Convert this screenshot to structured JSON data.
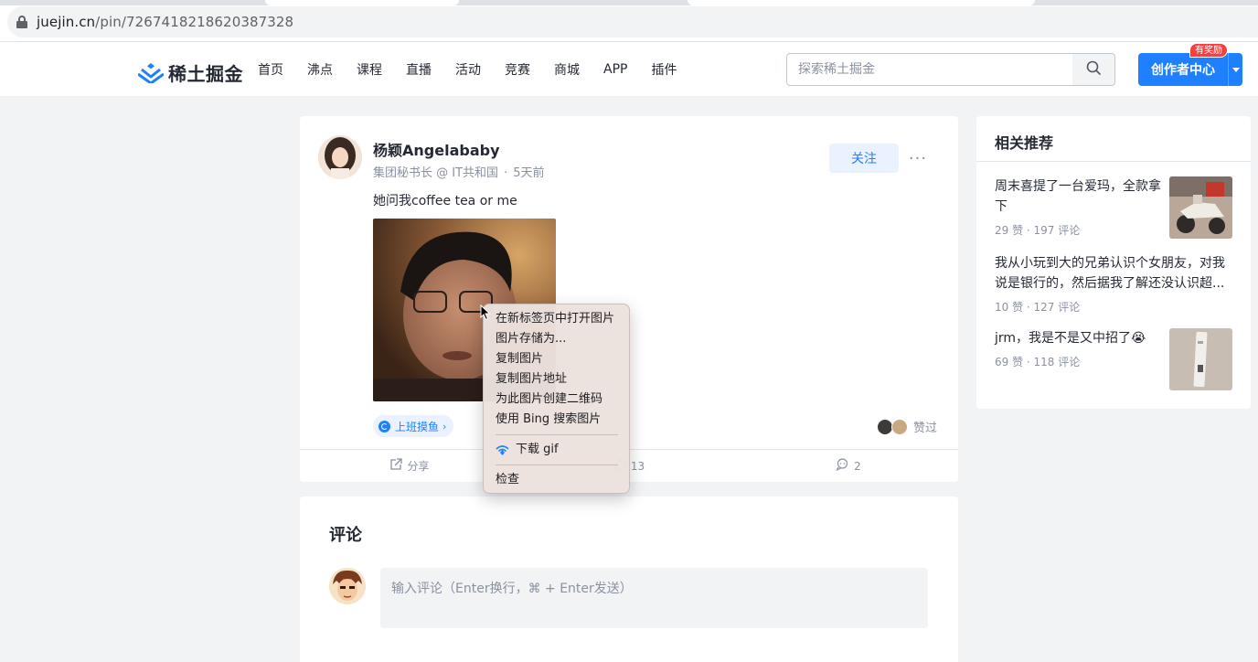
{
  "browser": {
    "url_host": "juejin.cn",
    "url_path": "/pin/7267418218620387328"
  },
  "header": {
    "logo_text": "稀土掘金",
    "nav": [
      "首页",
      "沸点",
      "课程",
      "直播",
      "活动",
      "竞赛",
      "商城",
      "APP",
      "插件"
    ],
    "search_placeholder": "探索稀土掘金",
    "creator_label": "创作者中心",
    "badge": "有奖励"
  },
  "post": {
    "author": "杨颖Angelababy",
    "author_title": "集团秘书长 @ IT共和国",
    "time": "5天前",
    "follow_label": "关注",
    "more_label": "···",
    "content": "她问我coffee tea or me",
    "topic": "上班摸鱼",
    "liked_label": "赞过",
    "actions": {
      "share": "分享",
      "like_count": "13",
      "comment_count": "2"
    }
  },
  "context_menu": {
    "items": [
      "在新标签页中打开图片",
      "图片存储为...",
      "复制图片",
      "复制图片地址",
      "为此图片创建二维码",
      "使用 Bing 搜索图片"
    ],
    "download": "下载 gif",
    "inspect": "检查"
  },
  "comments": {
    "title": "评论",
    "placeholder": "输入评论（Enter换行，⌘ + Enter发送）"
  },
  "sidebar": {
    "title": "相关推荐",
    "items": [
      {
        "title": "周末喜提了一台爱玛，全款拿下",
        "meta": "29 赞 · 197 评论"
      },
      {
        "title": "我从小玩到大的兄弟认识个女朋友，对我说是银行的，然后据我了解还没认识超...",
        "meta": "10 赞 · 127 评论"
      },
      {
        "title": "jrm，我是不是又中招了😭",
        "meta": "69 赞 · 118 评论"
      }
    ]
  },
  "colors": {
    "brand": "#1e80ff",
    "page_bg": "#f2f3f5",
    "text": "#252933",
    "muted": "#8a919f"
  }
}
